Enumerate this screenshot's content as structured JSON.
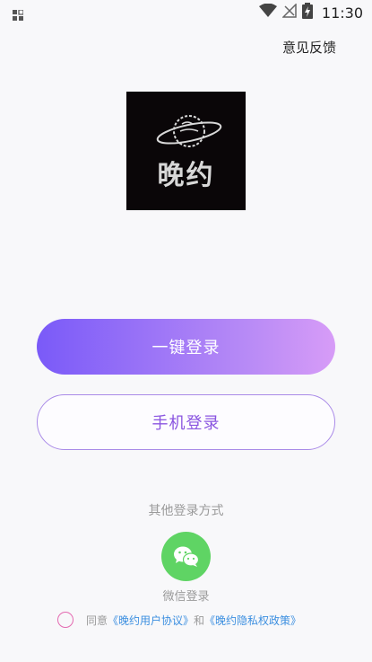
{
  "status_bar": {
    "time": "11:30",
    "icons": [
      "notification-grid-icon",
      "wifi-icon",
      "no-signal-icon",
      "battery-charging-icon"
    ]
  },
  "header": {
    "feedback_label": "意见反馈"
  },
  "logo": {
    "text": "晚约",
    "icon": "planet-icon"
  },
  "buttons": {
    "quick_login_label": "一键登录",
    "phone_login_label": "手机登录"
  },
  "other_login": {
    "title": "其他登录方式",
    "wechat_label": "微信登录",
    "wechat_icon": "wechat-icon"
  },
  "agreement": {
    "prefix": "同意",
    "user_agreement": "《晚约用户协议》",
    "conjunction": "和",
    "privacy_policy": "《晚约隐私权政策》"
  },
  "colors": {
    "gradient_start": "#7a5af8",
    "gradient_end": "#d79cf7",
    "accent_purple": "#8a55e0",
    "wechat_green": "#5fd464",
    "link_blue": "#3c8fe0",
    "checkbox_pink": "#e46ab1"
  }
}
